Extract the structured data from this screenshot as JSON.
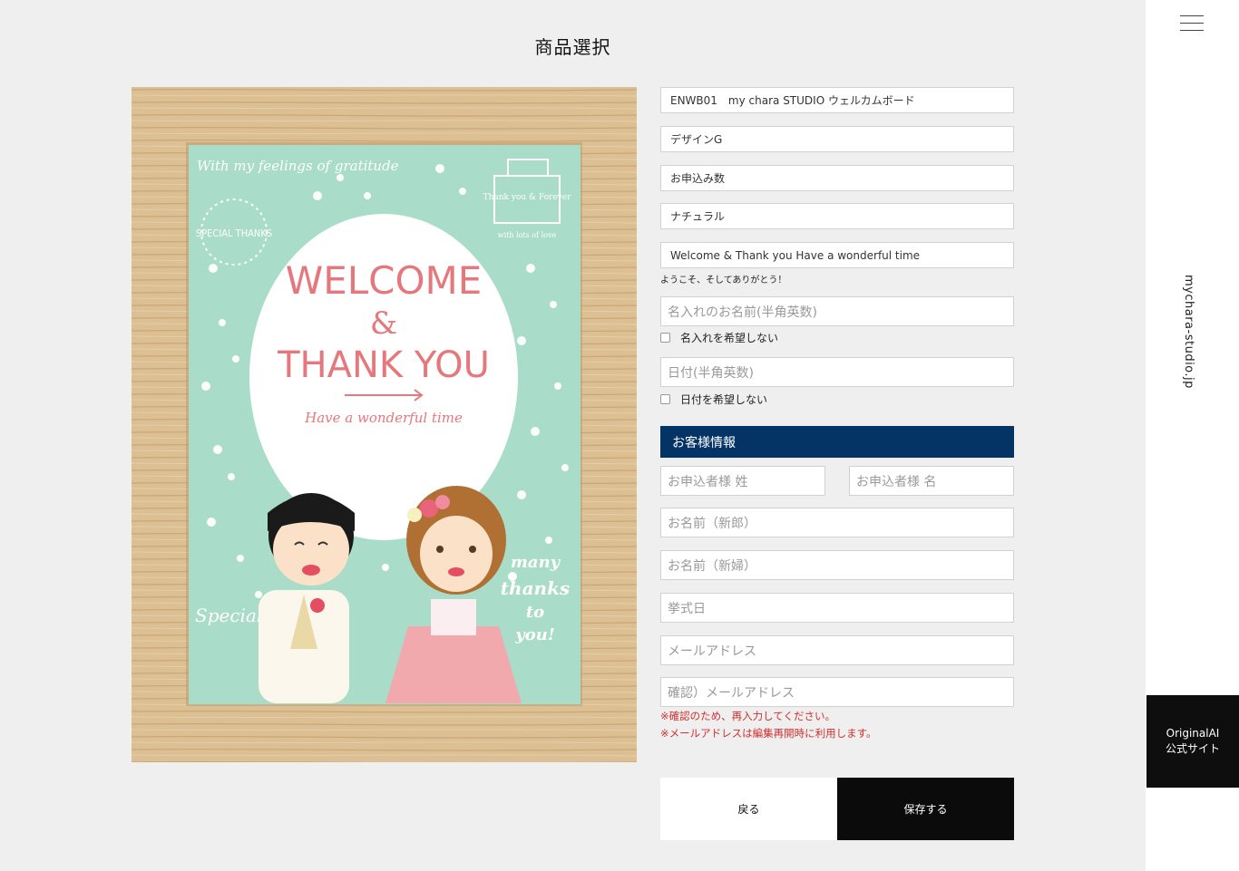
{
  "page": {
    "title": "商品選択"
  },
  "sidebar": {
    "site_name": "mychara-studio.jp",
    "official_line1": "OriginalAI",
    "official_line2": "公式サイト"
  },
  "board": {
    "script_top": "With my feelings of gratitude",
    "special_thanks": "SPECIAL THANKS",
    "cake_text": "Thank you & Forever",
    "cake_ribbon": "with lots of love",
    "welcome": "WELCOME",
    "amp": "&",
    "thank_you": "THANK YOU",
    "tagline": "Have a wonderful time",
    "special_day": "Special Day",
    "many": "many",
    "thanks": "thanks",
    "to": "to",
    "you": "you!",
    "colors": {
      "frame": "#d8b98a",
      "mint": "#a9dcc9",
      "pink": "#e5787c"
    }
  },
  "form": {
    "product_value": "ENWB01　my chara STUDIO ウェルカムボード",
    "design_value": "デザインG",
    "quantity_value": "お申込み数",
    "frame_value": "ナチュラル",
    "message_value": "Welcome & Thank you Have a wonderful time",
    "message_note": "ようこそ、そしてありがとう！",
    "name_placeholder": "名入れのお名前(半角英数)",
    "name_opt_out": "名入れを希望しない",
    "date_placeholder": "日付(半角英数)",
    "date_opt_out": "日付を希望しない"
  },
  "customer": {
    "header": "お客様情報",
    "last_name": "お申込者様 姓",
    "first_name": "お申込者様 名",
    "groom": "お名前（新郎）",
    "bride": "お名前（新婦）",
    "wedding_date": "挙式日",
    "email": "メールアドレス",
    "email_confirm": "確認）メールアドレス",
    "note1": "※確認のため、再入力してください。",
    "note2": "※メールアドレスは編集再開時に利用します。"
  },
  "actions": {
    "back": "戻る",
    "save": "保存する"
  }
}
